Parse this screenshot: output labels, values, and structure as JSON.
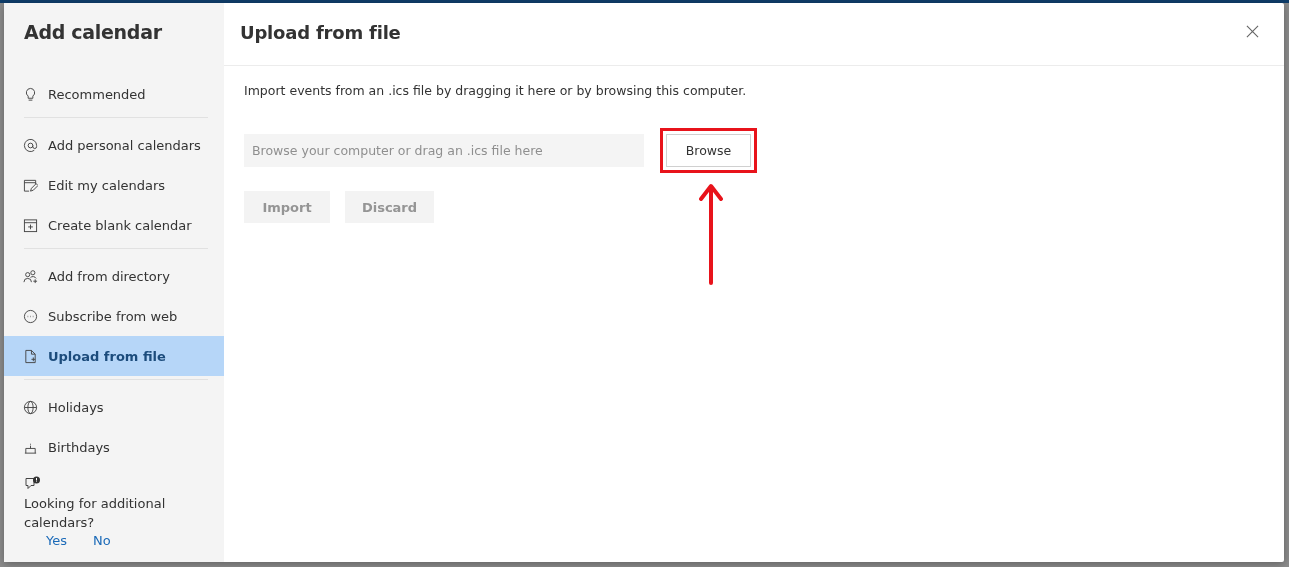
{
  "sidebar": {
    "title": "Add calendar",
    "groups": [
      [
        {
          "label": "Recommended",
          "selected": false
        }
      ],
      [
        {
          "label": "Add personal calendars",
          "selected": false
        },
        {
          "label": "Edit my calendars",
          "selected": false
        },
        {
          "label": "Create blank calendar",
          "selected": false
        }
      ],
      [
        {
          "label": "Add from directory",
          "selected": false
        },
        {
          "label": "Subscribe from web",
          "selected": false
        },
        {
          "label": "Upload from file",
          "selected": true
        }
      ],
      [
        {
          "label": "Holidays",
          "selected": false
        },
        {
          "label": "Birthdays",
          "selected": false
        }
      ]
    ],
    "feedback": {
      "question": "Looking for additional calendars?",
      "answers": [
        "Yes",
        "No"
      ]
    }
  },
  "panel": {
    "title": "Upload from file",
    "description": "Import events from an .ics file by dragging it here or by browsing this computer.",
    "file_field": {
      "placeholder": "Browse your computer or drag an .ics file here"
    },
    "browse_button": {
      "label": "Browse",
      "highlighted": true
    },
    "actions": [
      {
        "label": "Import",
        "disabled": true
      },
      {
        "label": "Discard",
        "disabled": true
      }
    ]
  }
}
